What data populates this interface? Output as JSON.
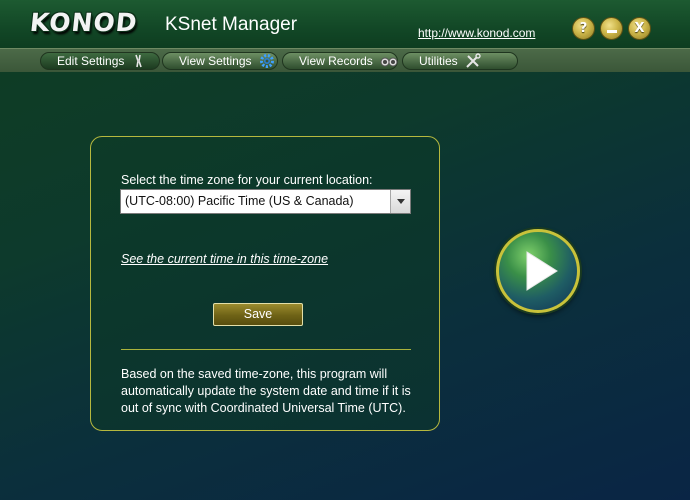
{
  "header": {
    "logo_text": "KONOD",
    "app_title": "KSnet Manager",
    "site_link": "http://www.konod.com",
    "help_label": "?",
    "minimize_label": "—",
    "close_label": "X"
  },
  "nav": {
    "tabs": [
      {
        "label": "Edit Settings",
        "icon": "wrench-pliers-icon",
        "active": true
      },
      {
        "label": "View Settings",
        "icon": "gear-icon",
        "active": false
      },
      {
        "label": "View Records",
        "icon": "binoculars-icon",
        "active": false
      },
      {
        "label": "Utilities",
        "icon": "tools-icon",
        "active": false
      }
    ]
  },
  "panel": {
    "timezone_label": "Select the time zone for your current location:",
    "timezone_selected": "(UTC-08:00) Pacific Time (US & Canada)",
    "time_link": "See the current time in this time-zone",
    "save_label": "Save",
    "info_text": "Based on the saved time-zone, this program will automatically update the system date and time if it is out of sync with Coordinated Universal Time (UTC)."
  },
  "colors": {
    "accent_gold": "#c8c23a",
    "panel_border": "#b6b83e",
    "header_green": "#124726"
  },
  "play_button": {
    "icon": "play-icon"
  }
}
